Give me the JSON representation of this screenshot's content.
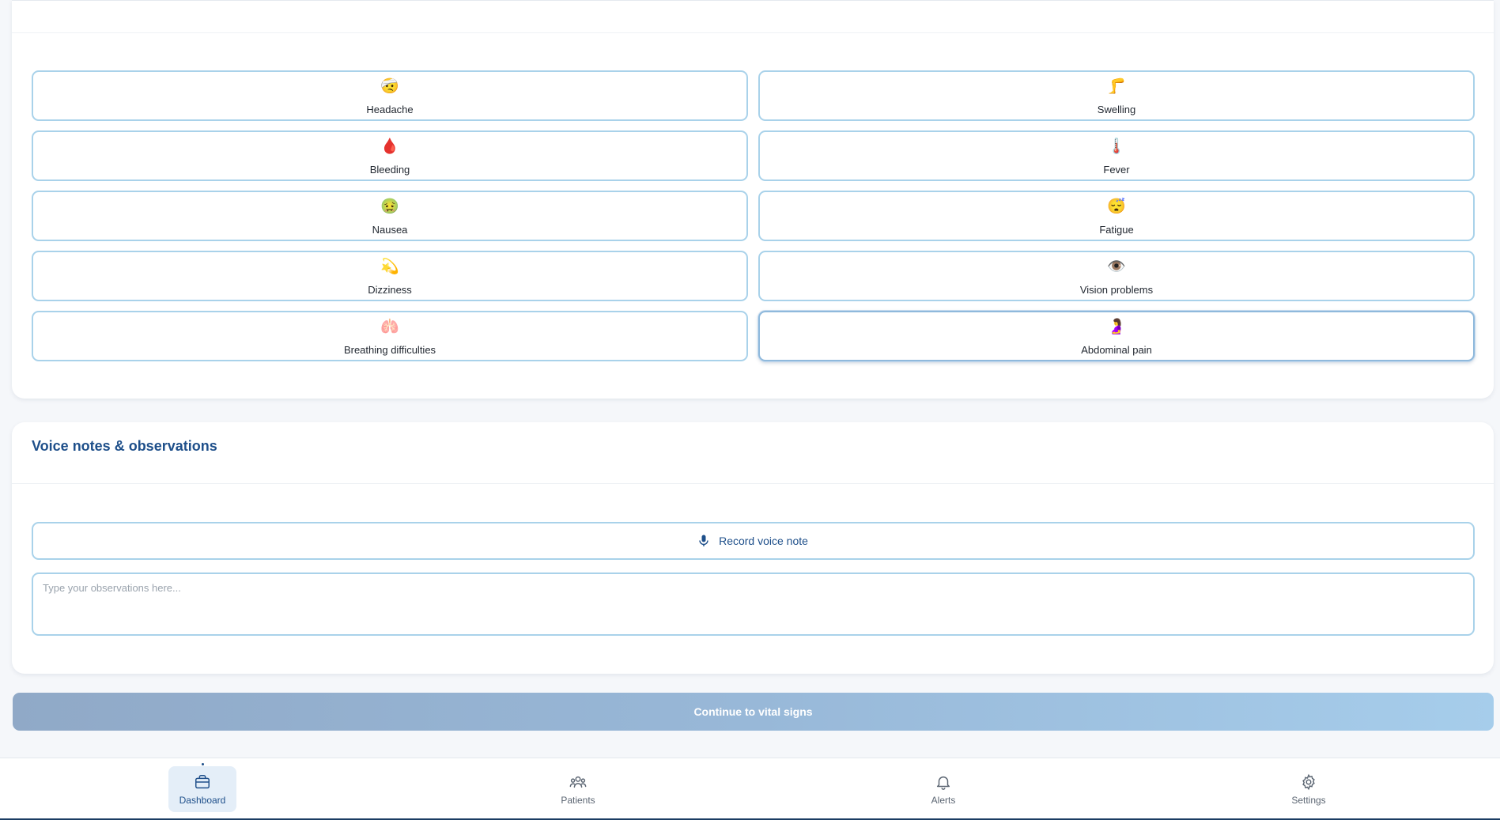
{
  "symptoms": [
    {
      "label": "Headache",
      "icon": "🤕",
      "icon_name": "headache-icon"
    },
    {
      "label": "Swelling",
      "icon": "🦵",
      "icon_name": "swelling-icon"
    },
    {
      "label": "Bleeding",
      "icon": "🩸",
      "icon_name": "bleeding-icon"
    },
    {
      "label": "Fever",
      "icon": "🌡️",
      "icon_name": "fever-icon"
    },
    {
      "label": "Nausea",
      "icon": "🤢",
      "icon_name": "nausea-icon"
    },
    {
      "label": "Fatigue",
      "icon": "😴",
      "icon_name": "fatigue-icon"
    },
    {
      "label": "Dizziness",
      "icon": "💫",
      "icon_name": "dizziness-icon"
    },
    {
      "label": "Vision problems",
      "icon": "👁️",
      "icon_name": "vision-icon"
    },
    {
      "label": "Breathing difficulties",
      "icon": "🫁",
      "icon_name": "lungs-icon"
    },
    {
      "label": "Abdominal pain",
      "icon": "🤰",
      "icon_name": "abdominal-icon"
    }
  ],
  "voice": {
    "title": "Voice notes & observations",
    "record_label": "Record voice note",
    "notes_placeholder": "Type your observations here..."
  },
  "continue_label": "Continue to vital signs",
  "nav": [
    {
      "label": "Dashboard",
      "icon_name": "briefcase-icon",
      "active": true
    },
    {
      "label": "Patients",
      "icon_name": "users-icon",
      "active": false
    },
    {
      "label": "Alerts",
      "icon_name": "bell-icon",
      "active": false
    },
    {
      "label": "Settings",
      "icon_name": "gear-icon",
      "active": false
    }
  ],
  "colors": {
    "accent": "#1e4f8a",
    "border": "#a9d2ea",
    "button_gradient_start": "#90a9c7",
    "button_gradient_end": "#a6cdeb"
  }
}
